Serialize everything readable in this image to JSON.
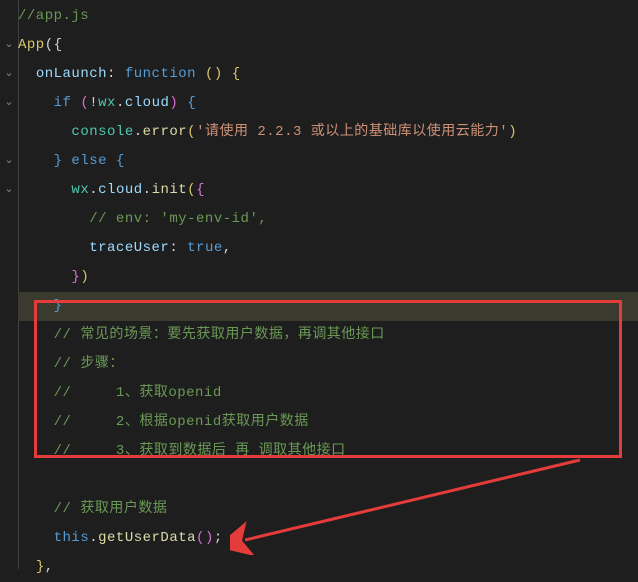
{
  "lines": {
    "l1": "//app.js",
    "l2_app": "App",
    "l2_rest": "({",
    "l3_key": "onLaunch",
    "l3_colon": ": ",
    "l3_func": "function ",
    "l3_paren": "() ",
    "l3_brace": "{",
    "l4_if": "if ",
    "l4_p1": "(",
    "l4_not": "!",
    "l4_wx": "wx",
    "l4_dot": ".",
    "l4_cloud": "cloud",
    "l4_p2": ") ",
    "l4_brace": "{",
    "l5_console": "console",
    "l5_dot": ".",
    "l5_error": "error",
    "l5_p1": "(",
    "l5_str": "'请使用 2.2.3 或以上的基础库以使用云能力'",
    "l5_p2": ")",
    "l6_b1": "} ",
    "l6_else": "else ",
    "l6_b2": "{",
    "l7_wx": "wx",
    "l7_d1": ".",
    "l7_cloud": "cloud",
    "l7_d2": ".",
    "l7_init": "init",
    "l7_p1": "(",
    "l7_b": "{",
    "l8": "// env: 'my-env-id',",
    "l9_key": "traceUser",
    "l9_colon": ": ",
    "l9_true": "true",
    "l9_comma": ",",
    "l10_b": "}",
    "l10_p": ")",
    "l11": "}",
    "l12": "// 常见的场景：要先获取用户数据，再调其他接口",
    "l13": "// 步骤：",
    "l14": "//     1、获取openid",
    "l15": "//     2、根据openid获取用户数据",
    "l16": "//     3、获取到数据后 再 调取其他接口",
    "l17": "",
    "l18": "// 获取用户数据",
    "l19_this": "this",
    "l19_dot": ".",
    "l19_fn": "getUserData",
    "l19_paren": "()",
    "l19_semi": ";",
    "l20_b": "}",
    "l20_c": ","
  }
}
